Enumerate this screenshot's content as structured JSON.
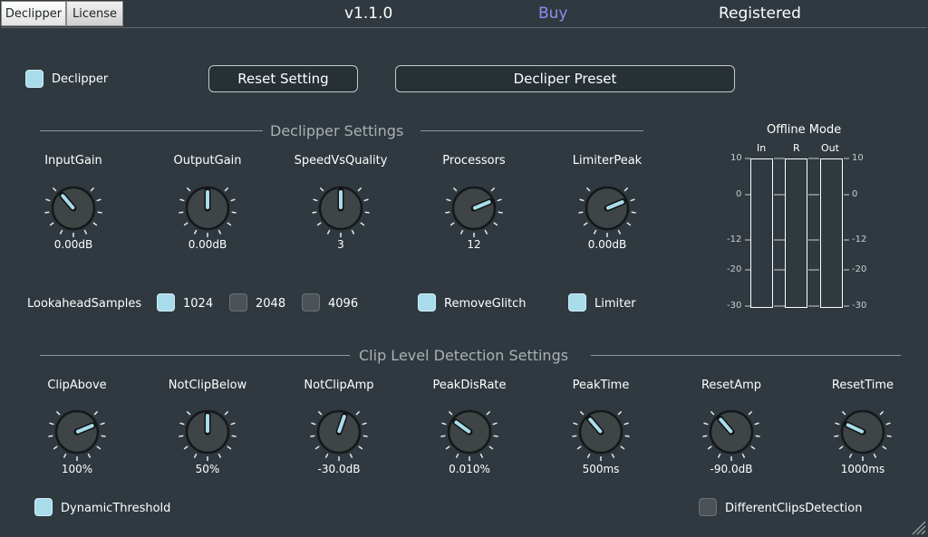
{
  "tabs": [
    {
      "label": "Declipper"
    },
    {
      "label": "License"
    }
  ],
  "header": {
    "version": "v1.1.0",
    "buy": "Buy",
    "status": "Registered"
  },
  "colors": {
    "background": "#2f393f",
    "checkbox_on": "#a9dcea",
    "checkbox_off": "#4b5358",
    "buy_link": "#8e8cf0",
    "knob_pointer": "#a9dcea"
  },
  "top": {
    "declipper_toggle": {
      "label": "Declipper",
      "checked": true
    },
    "reset_button": "Reset Setting",
    "preset_button": "Decliper Preset"
  },
  "declipper_settings": {
    "title": "Declipper Settings",
    "knobs": [
      {
        "label": "InputGain",
        "value": "0.00dB",
        "position": 0.35
      },
      {
        "label": "OutputGain",
        "value": "0.00dB",
        "position": 0.5
      },
      {
        "label": "SpeedVsQuality",
        "value": "3",
        "position": 0.5
      },
      {
        "label": "Processors",
        "value": "12",
        "position": 0.75
      },
      {
        "label": "LimiterPeak",
        "value": "0.00dB",
        "position": 0.75
      }
    ],
    "lookahead": {
      "label": "LookaheadSamples",
      "options": [
        {
          "label": "1024",
          "checked": true
        },
        {
          "label": "2048",
          "checked": false
        },
        {
          "label": "4096",
          "checked": false
        }
      ]
    },
    "remove_glitch": {
      "label": "RemoveGlitch",
      "checked": true
    },
    "limiter": {
      "label": "Limiter",
      "checked": true
    }
  },
  "offline_meter": {
    "title": "Offline Mode",
    "channels": [
      "In",
      "R",
      "Out"
    ],
    "ticks": [
      "10",
      "0",
      "-12",
      "-20",
      "-30"
    ]
  },
  "clip_settings": {
    "title": "Clip Level Detection Settings",
    "knobs": [
      {
        "label": "ClipAbove",
        "value": "100%",
        "position": 0.75
      },
      {
        "label": "NotClipBelow",
        "value": "50%",
        "position": 0.5
      },
      {
        "label": "NotClipAmp",
        "value": "-30.0dB",
        "position": 0.57
      },
      {
        "label": "PeakDisRate",
        "value": "0.010%",
        "position": 0.3
      },
      {
        "label": "PeakTime",
        "value": "500ms",
        "position": 0.35
      },
      {
        "label": "ResetAmp",
        "value": "-90.0dB",
        "position": 0.35
      },
      {
        "label": "ResetTime",
        "value": "1000ms",
        "position": 0.26
      }
    ],
    "dynamic_threshold": {
      "label": "DynamicThreshold",
      "checked": true
    },
    "different_clips": {
      "label": "DifferentClipsDetection",
      "checked": false
    }
  }
}
